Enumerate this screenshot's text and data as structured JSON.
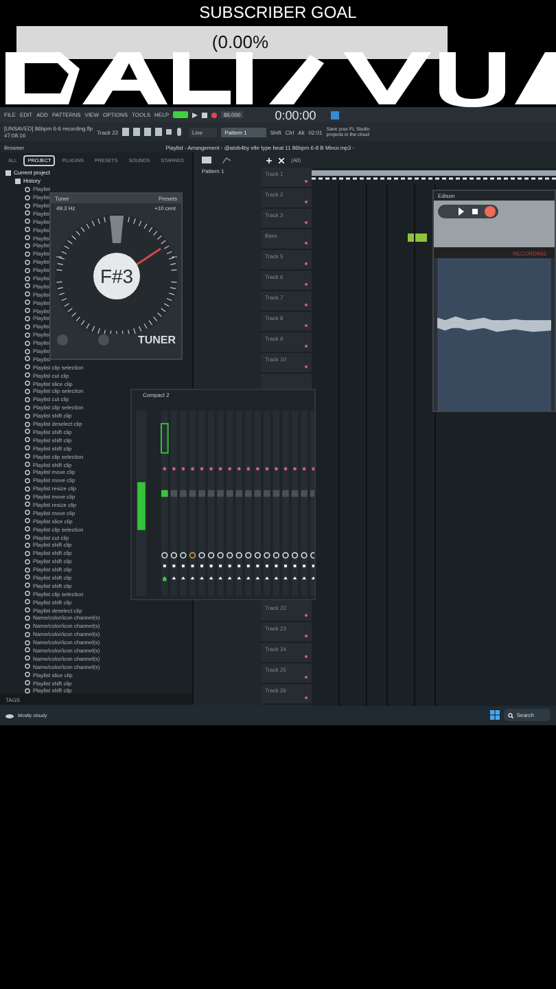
{
  "overlay": {
    "title": "SUBSCRIBER GOAL",
    "progress": "(0.00%",
    "level": 0
  },
  "menu": [
    "FILE",
    "EDIT",
    "ADD",
    "PATTERNS",
    "VIEW",
    "OPTIONS",
    "TOOLS",
    "HELP"
  ],
  "transport": {
    "song_mode": true,
    "tempo": "86.000",
    "time": "0:00:00"
  },
  "project": {
    "name": "[UNSAVED] 86bpm 6-6 recording.flp",
    "time": "47:08:16",
    "track": "Track 22"
  },
  "toolbar": {
    "snap": "Line",
    "pattern": "Pattern 1",
    "modifiers": [
      "Shift",
      "Ctrl",
      "Alt"
    ],
    "hint_time": "02:01",
    "hint": "Save your FL Studio projects in the cloud"
  },
  "browser": {
    "title": "Browser",
    "tabs": [
      {
        "label": "ALL",
        "selected": false
      },
      {
        "label": "PROJECT",
        "selected": true
      },
      {
        "label": "PLUGINS",
        "selected": false
      },
      {
        "label": "PRESETS",
        "selected": false
      },
      {
        "label": "SOUNDS",
        "selected": false
      },
      {
        "label": "STARRED",
        "selected": false
      }
    ],
    "tree": [
      {
        "label": "Current project",
        "children": [
          {
            "label": "History",
            "children": [
              {
                "label": "Playlist"
              },
              {
                "label": "Playlist"
              },
              {
                "label": "Playlist"
              },
              {
                "label": "Playlist"
              },
              {
                "label": "Playlist"
              },
              {
                "label": "Playlist"
              },
              {
                "label": "Playlist"
              },
              {
                "label": "Playlist"
              },
              {
                "label": "Playlist"
              },
              {
                "label": "Playlist"
              },
              {
                "label": "Playlist"
              },
              {
                "label": "Playlist"
              },
              {
                "label": "Playlist"
              },
              {
                "label": "Playlist"
              },
              {
                "label": "Playlist"
              },
              {
                "label": "Playlist"
              },
              {
                "label": "Playlist"
              },
              {
                "label": "Playlist"
              },
              {
                "label": "Playlist"
              },
              {
                "label": "Playlist"
              },
              {
                "label": "Playlist"
              },
              {
                "label": "Playlist"
              },
              {
                "label": "Playlist clip selection"
              },
              {
                "label": "Playlist cut clip"
              },
              {
                "label": "Playlist slice clip"
              },
              {
                "label": "Playlist clip selection"
              },
              {
                "label": "Playlist cut clip"
              },
              {
                "label": "Playlist clip selection"
              },
              {
                "label": "Playlist shift clip"
              },
              {
                "label": "Playlist deselect clip"
              },
              {
                "label": "Playlist shift clip"
              },
              {
                "label": "Playlist shift clip"
              },
              {
                "label": "Playlist shift clip"
              },
              {
                "label": "Playlist clip selection"
              },
              {
                "label": "Playlist shift clip"
              },
              {
                "label": "Playlist move clip"
              },
              {
                "label": "Playlist move clip"
              },
              {
                "label": "Playlist resize clip"
              },
              {
                "label": "Playlist move clip"
              },
              {
                "label": "Playlist resize clip"
              },
              {
                "label": "Playlist move clip"
              },
              {
                "label": "Playlist slice clip"
              },
              {
                "label": "Playlist clip selection"
              },
              {
                "label": "Playlist cut clip"
              },
              {
                "label": "Playlist shift clip"
              },
              {
                "label": "Playlist shift clip"
              },
              {
                "label": "Playlist shift clip"
              },
              {
                "label": "Playlist shift clip"
              },
              {
                "label": "Playlist shift clip"
              },
              {
                "label": "Playlist shift clip"
              },
              {
                "label": "Playlist clip selection"
              },
              {
                "label": "Playlist shift clip"
              },
              {
                "label": "Playlist deselect clip"
              },
              {
                "label": "Name/color/icon channel(s)"
              },
              {
                "label": "Name/color/icon channel(s)"
              },
              {
                "label": "Name/color/icon channel(s)"
              },
              {
                "label": "Name/color/icon channel(s)"
              },
              {
                "label": "Name/color/icon channel(s)"
              },
              {
                "label": "Name/color/icon channel(s)"
              },
              {
                "label": "Name/color/icon channel(s)"
              },
              {
                "label": "Playlist slice clip"
              },
              {
                "label": "Playlist shift clip"
              },
              {
                "label": "Playlist shift clip"
              }
            ]
          }
        ]
      }
    ],
    "footer": "TAGS"
  },
  "channel_rack": {
    "pattern": "Pattern 1"
  },
  "playlist": {
    "title": "Playlist - Arrangement - @atob4by elle type beat 11 86bpm 6-8 B Minor.mp3 -",
    "snap": "(All)",
    "tracks": [
      "Track 1",
      "Track 2",
      "Track 3",
      "Bass",
      "Track 5",
      "Track 6",
      "Track 7",
      "Track 8",
      "Track 9",
      "Track 10"
    ],
    "lower_tracks": [
      "Track 22",
      "Track 23",
      "Track 24",
      "Track 25",
      "Track 26"
    ]
  },
  "tuner": {
    "title": "Tuner",
    "presets": "Presets",
    "frequency": "49.3 Hz",
    "cents": "+10 cent",
    "note": "F#3",
    "brand": "TUNER"
  },
  "edison": {
    "title": "Edison",
    "status": "RECORDING"
  },
  "mixer": {
    "title": "Compact 2"
  },
  "taskbar": {
    "weather": "Mostly cloudy",
    "search": "Search"
  }
}
